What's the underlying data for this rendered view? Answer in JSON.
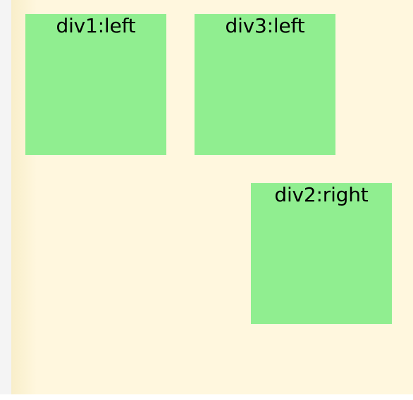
{
  "boxes": {
    "div1": "div1:left",
    "div3": "div3:left",
    "div2": "div2:right"
  },
  "colors": {
    "page_background": "#f4f4f4",
    "container_background": "#fff7de",
    "box_fill": "#90ee90",
    "text": "#000000"
  }
}
